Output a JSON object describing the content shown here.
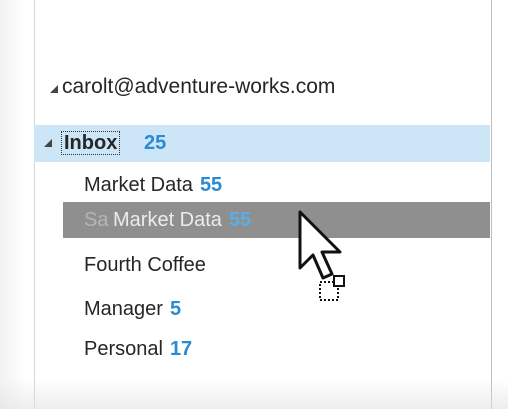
{
  "account": {
    "email": "carolt@adventure-works.com"
  },
  "inbox": {
    "label": "Inbox",
    "unread": "25"
  },
  "folders": [
    {
      "label": "Market Data",
      "unread": "55"
    },
    {
      "label": "Sales",
      "unread": ""
    },
    {
      "label": "Fourth Coffee",
      "unread": ""
    },
    {
      "label": "Manager",
      "unread": "5"
    },
    {
      "label": "Personal",
      "unread": "17"
    }
  ],
  "drag": {
    "label": "Market Data",
    "unread": "55",
    "covered_folder_text": "Sa"
  },
  "colors": {
    "selection": "#cde6f7",
    "count": "#2a8ad4",
    "drag_band": "#8f8f8f"
  }
}
